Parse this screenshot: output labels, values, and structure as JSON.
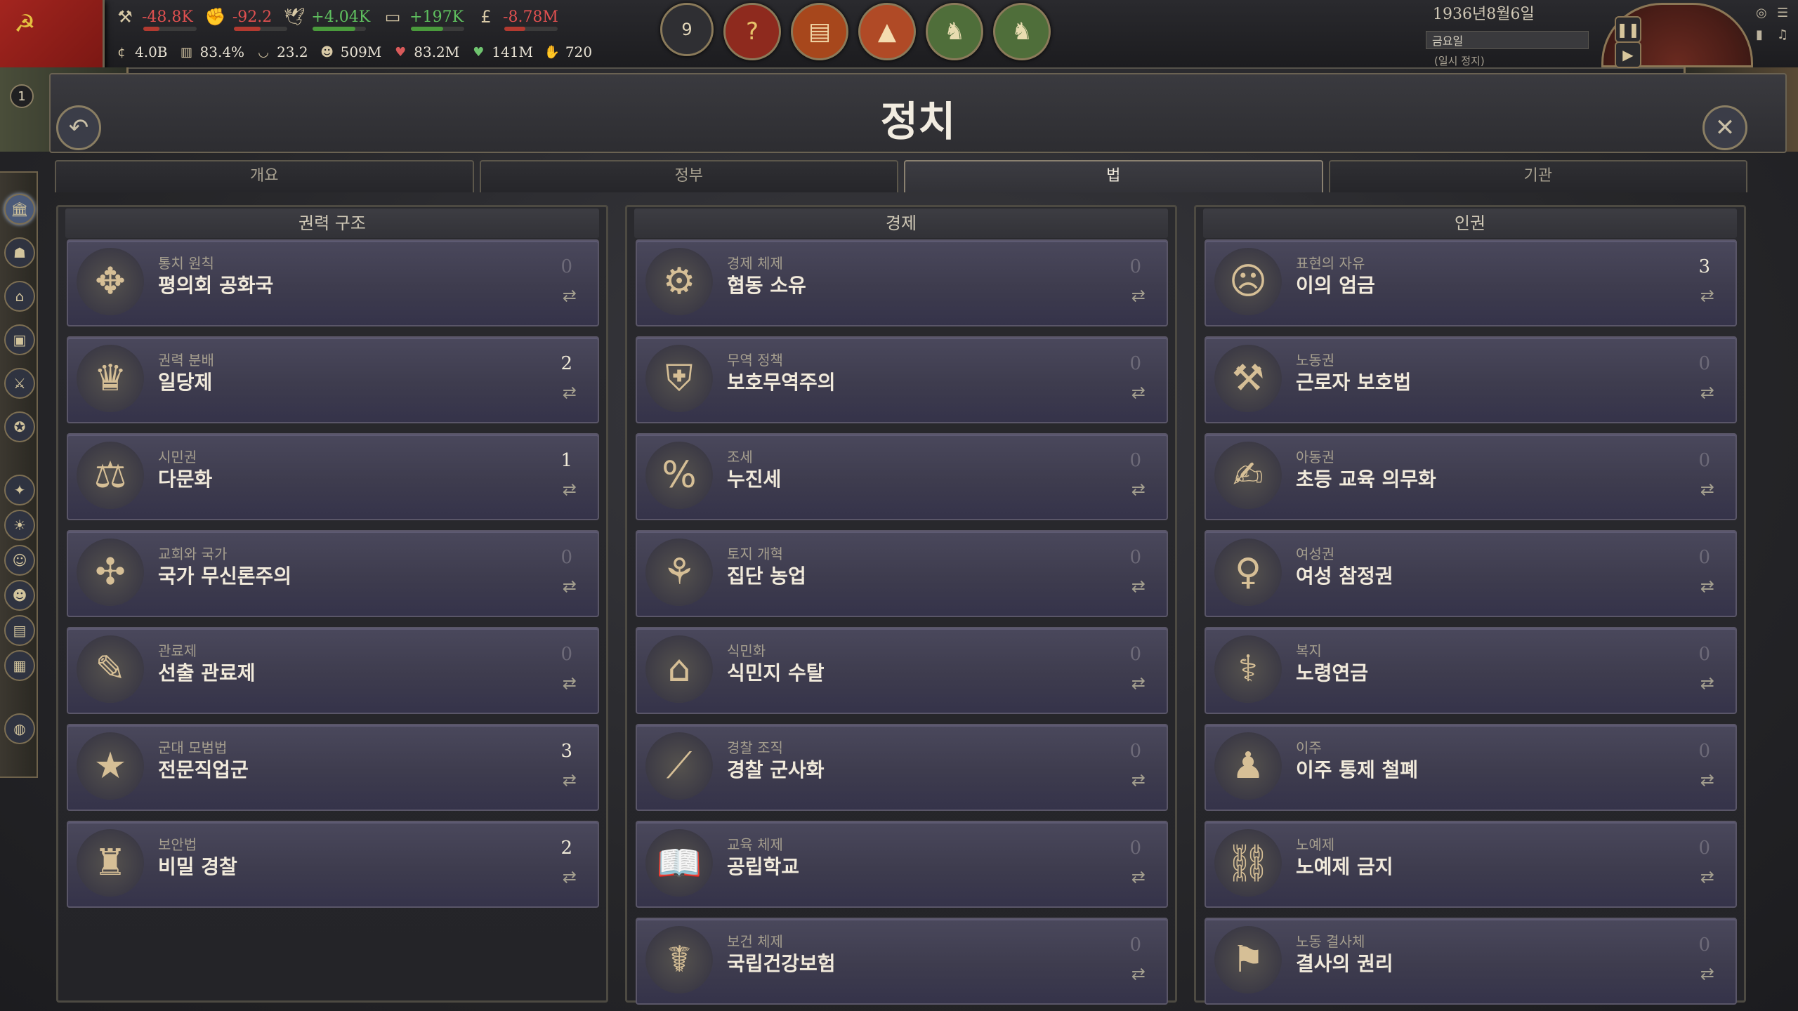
{
  "top_resources": [
    {
      "icon": "hammer-icon",
      "value": "-48.8K",
      "sign": "neg",
      "bar_fraction": 0.3,
      "bar_color": "#b23a30"
    },
    {
      "icon": "fist-icon",
      "value": "-92.2",
      "sign": "neg",
      "bar_fraction": 0.5,
      "bar_color": "#b23a30"
    },
    {
      "icon": "dove-icon",
      "value": "+4.04K",
      "sign": "pos",
      "bar_fraction": 0.8,
      "bar_color": "#4a9a3c"
    },
    {
      "icon": "goods-icon",
      "value": "+197K",
      "sign": "pos",
      "bar_fraction": 0.6,
      "bar_color": "#4a9a3c"
    },
    {
      "icon": "pound-icon",
      "value": "-8.78M",
      "sign": "neg",
      "bar_fraction": 0.4,
      "bar_color": "#b23a30"
    }
  ],
  "sub_resources": [
    {
      "icon": "money-icon",
      "value": "4.0B"
    },
    {
      "icon": "books-icon",
      "value": "83.4%"
    },
    {
      "icon": "bowl-icon",
      "value": "23.2"
    },
    {
      "icon": "people-icon",
      "value": "509M"
    },
    {
      "icon": "heart-icon",
      "value": "83.2M"
    },
    {
      "icon": "green-heart-icon",
      "value": "141M"
    },
    {
      "icon": "hand-icon",
      "value": "720"
    }
  ],
  "alerts": [
    {
      "icon": "count-badge",
      "text": "9"
    },
    {
      "icon": "question-icon",
      "text": "?"
    },
    {
      "icon": "stocks-icon",
      "text": "▤"
    },
    {
      "icon": "factory-icon",
      "text": "▲"
    },
    {
      "icon": "laurel-chess-icon",
      "text": "♞"
    },
    {
      "icon": "laurel-chess-icon",
      "text": "♞"
    }
  ],
  "date": "1936년8월6일",
  "speed_label": "금요일",
  "paused_label": "(일시 정지)",
  "level_badge": "1",
  "page_title": "정치",
  "tabs": [
    "개요",
    "정부",
    "법",
    "기관"
  ],
  "active_tab": "법",
  "columns": [
    {
      "title": "권력 구조",
      "laws": [
        {
          "category": "통치 원칙",
          "name": "평의회 공화국",
          "count": "0",
          "icon": "hands-icon"
        },
        {
          "category": "권력 분배",
          "name": "일당제",
          "count": "2",
          "icon": "council-icon"
        },
        {
          "category": "시민권",
          "name": "다문화",
          "count": "1",
          "icon": "scales-icon"
        },
        {
          "category": "교회와 국가",
          "name": "국가 무신론주의",
          "count": "0",
          "icon": "vitruvian-icon"
        },
        {
          "category": "관료제",
          "name": "선출 관료제",
          "count": "0",
          "icon": "quill-icon"
        },
        {
          "category": "군대 모범법",
          "name": "전문직업군",
          "count": "3",
          "icon": "medal-icon"
        },
        {
          "category": "보안법",
          "name": "비밀 경찰",
          "count": "2",
          "icon": "spy-icon"
        }
      ]
    },
    {
      "title": "경제",
      "laws": [
        {
          "category": "경제 체제",
          "name": "협동 소유",
          "count": "0",
          "icon": "cooperative-icon"
        },
        {
          "category": "무역 정책",
          "name": "보호무역주의",
          "count": "0",
          "icon": "shield-factory-icon"
        },
        {
          "category": "조세",
          "name": "누진세",
          "count": "0",
          "icon": "percent-icon"
        },
        {
          "category": "토지 개혁",
          "name": "집단 농업",
          "count": "0",
          "icon": "farmers-icon"
        },
        {
          "category": "식민화",
          "name": "식민지 수탈",
          "count": "0",
          "icon": "colony-icon"
        },
        {
          "category": "경찰 조직",
          "name": "경찰 군사화",
          "count": "0",
          "icon": "baton-icon"
        },
        {
          "category": "교육 체제",
          "name": "공립학교",
          "count": "0",
          "icon": "book-icon"
        },
        {
          "category": "보건 체제",
          "name": "국립건강보험",
          "count": "0",
          "icon": "caduceus-icon"
        }
      ]
    },
    {
      "title": "인권",
      "laws": [
        {
          "category": "표현의 자유",
          "name": "이의 엄금",
          "count": "3",
          "icon": "gagged-head-icon"
        },
        {
          "category": "노동권",
          "name": "근로자 보호법",
          "count": "0",
          "icon": "tools-shield-icon"
        },
        {
          "category": "아동권",
          "name": "초등 교육 의무화",
          "count": "0",
          "icon": "schoolchild-icon"
        },
        {
          "category": "여성권",
          "name": "여성 참정권",
          "count": "0",
          "icon": "venus-icon"
        },
        {
          "category": "복지",
          "name": "노령연금",
          "count": "0",
          "icon": "cane-icon"
        },
        {
          "category": "이주",
          "name": "이주 통제 철폐",
          "count": "0",
          "icon": "traveler-icon"
        },
        {
          "category": "노예제",
          "name": "노예제 금지",
          "count": "0",
          "icon": "broken-chain-icon"
        },
        {
          "category": "노동 결사체",
          "name": "결사의 권리",
          "count": "0",
          "icon": "union-icon"
        }
      ]
    }
  ]
}
